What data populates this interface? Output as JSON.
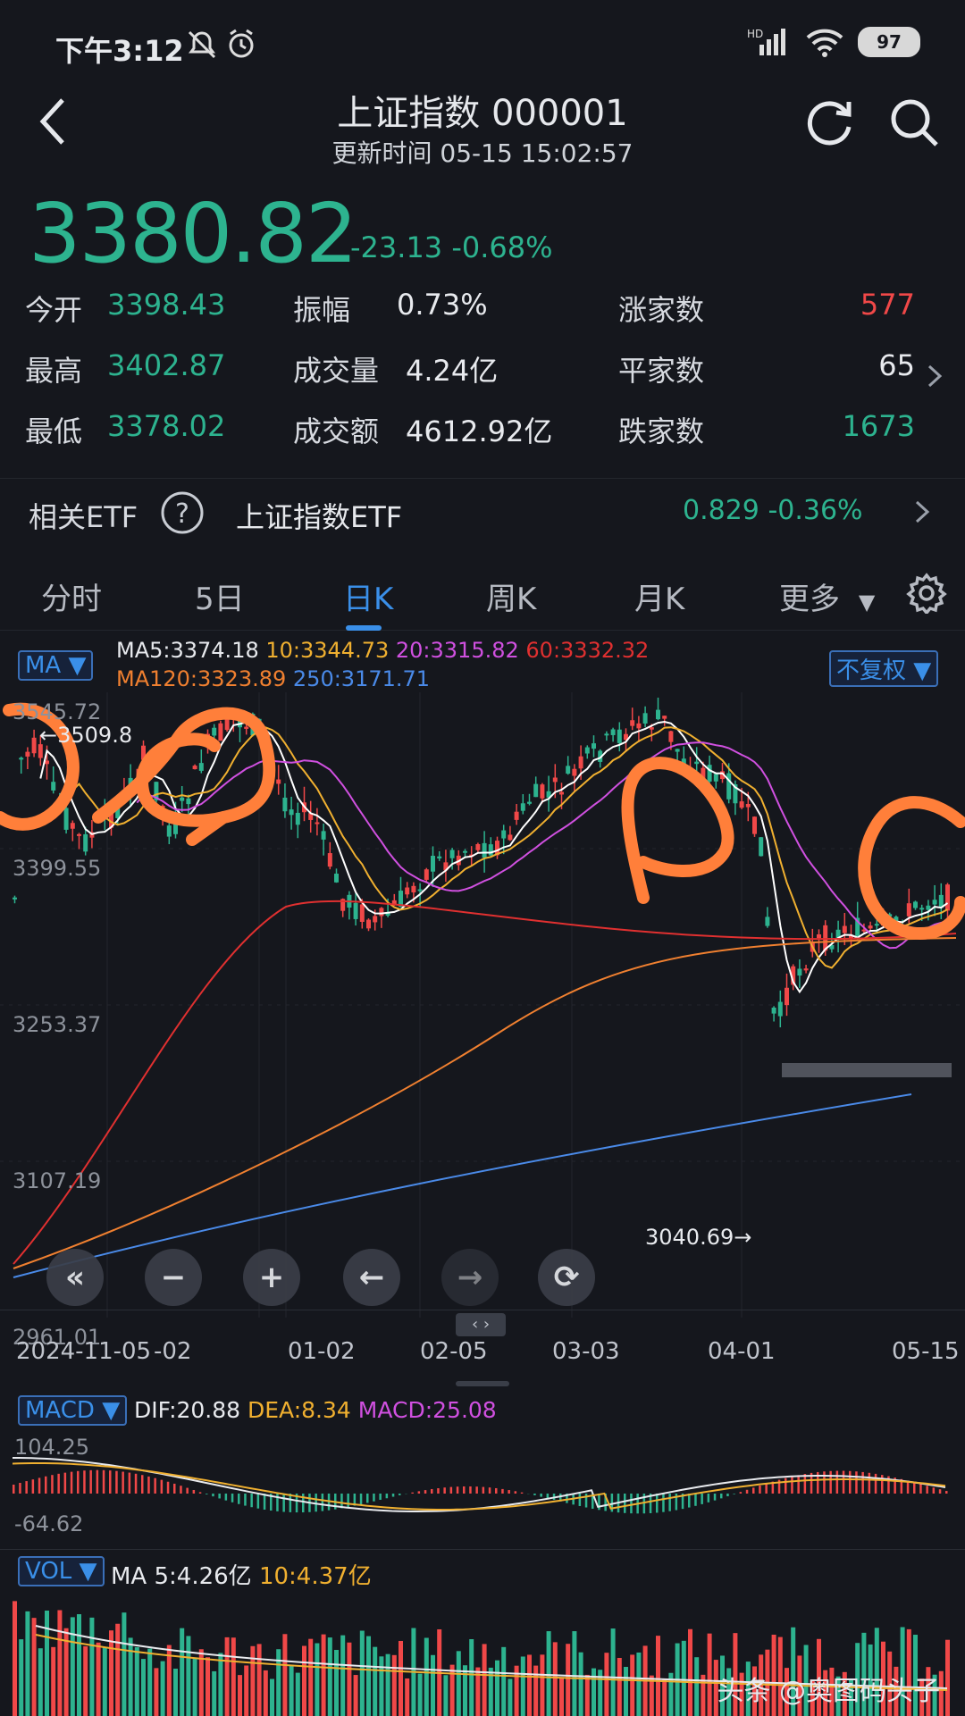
{
  "status_bar": {
    "time": "下午3:12",
    "battery": "97",
    "network": "HD"
  },
  "header": {
    "title": "上证指数 000001",
    "subtitle": "更新时间 05-15 15:02:57"
  },
  "quote": {
    "price": "3380.82",
    "change": "-23.13",
    "change_pct": "-0.68%"
  },
  "stats": [
    {
      "label": "今开",
      "value": "3398.43"
    },
    {
      "label": "振幅",
      "value": "0.73%"
    },
    {
      "label": "涨家数",
      "value": "577"
    },
    {
      "label": "最高",
      "value": "3402.87"
    },
    {
      "label": "成交量",
      "value": "4.24亿"
    },
    {
      "label": "平家数",
      "value": "65"
    },
    {
      "label": "最低",
      "value": "3378.02"
    },
    {
      "label": "成交额",
      "value": "4612.92亿"
    },
    {
      "label": "跌家数",
      "value": "1673"
    }
  ],
  "etf": {
    "label": "相关ETF",
    "name": "上证指数ETF",
    "price": "0.829",
    "change_pct": "-0.36%"
  },
  "tabs": [
    {
      "label": "分时"
    },
    {
      "label": "5日"
    },
    {
      "label": "日K"
    },
    {
      "label": "周K"
    },
    {
      "label": "月K"
    },
    {
      "label": "更多"
    }
  ],
  "ma": {
    "chip": "MA",
    "ma5": "MA5:3374.18",
    "ma10": "10:3344.73",
    "ma20": "20:3315.82",
    "ma60": "60:3332.32",
    "ma120": "MA120:3323.89",
    "ma250": "250:3171.71",
    "adjust": "不复权"
  },
  "price_axis": [
    "3545.72",
    "3399.55",
    "3253.37",
    "3107.19",
    "2961.01"
  ],
  "annotations": {
    "high": "←3509.8",
    "low": "3040.69→"
  },
  "date_axis": [
    "2024-11-05",
    "-02",
    "01-02",
    "02-05",
    "03-03",
    "04-01",
    "05-15"
  ],
  "macd": {
    "chip": "MACD",
    "dif": "DIF:20.88",
    "dea": "DEA:8.34",
    "macd": "MACD:25.08",
    "top": "104.25",
    "bottom": "-64.62"
  },
  "vol": {
    "chip": "VOL",
    "ma5": "MA 5:4.26亿",
    "ma10": "10:4.37亿"
  },
  "watermark": "头条 @奥图码头子",
  "colors": {
    "up": "#f04848",
    "down": "#2db38f",
    "accent": "#3a8fe8",
    "ma5": "#ffffff",
    "ma10": "#f0b030",
    "ma20": "#d050e0",
    "ma60": "#e03030",
    "ma120": "#f08030",
    "ma250": "#4a8ae8",
    "mark": "#ff7f3a"
  }
}
